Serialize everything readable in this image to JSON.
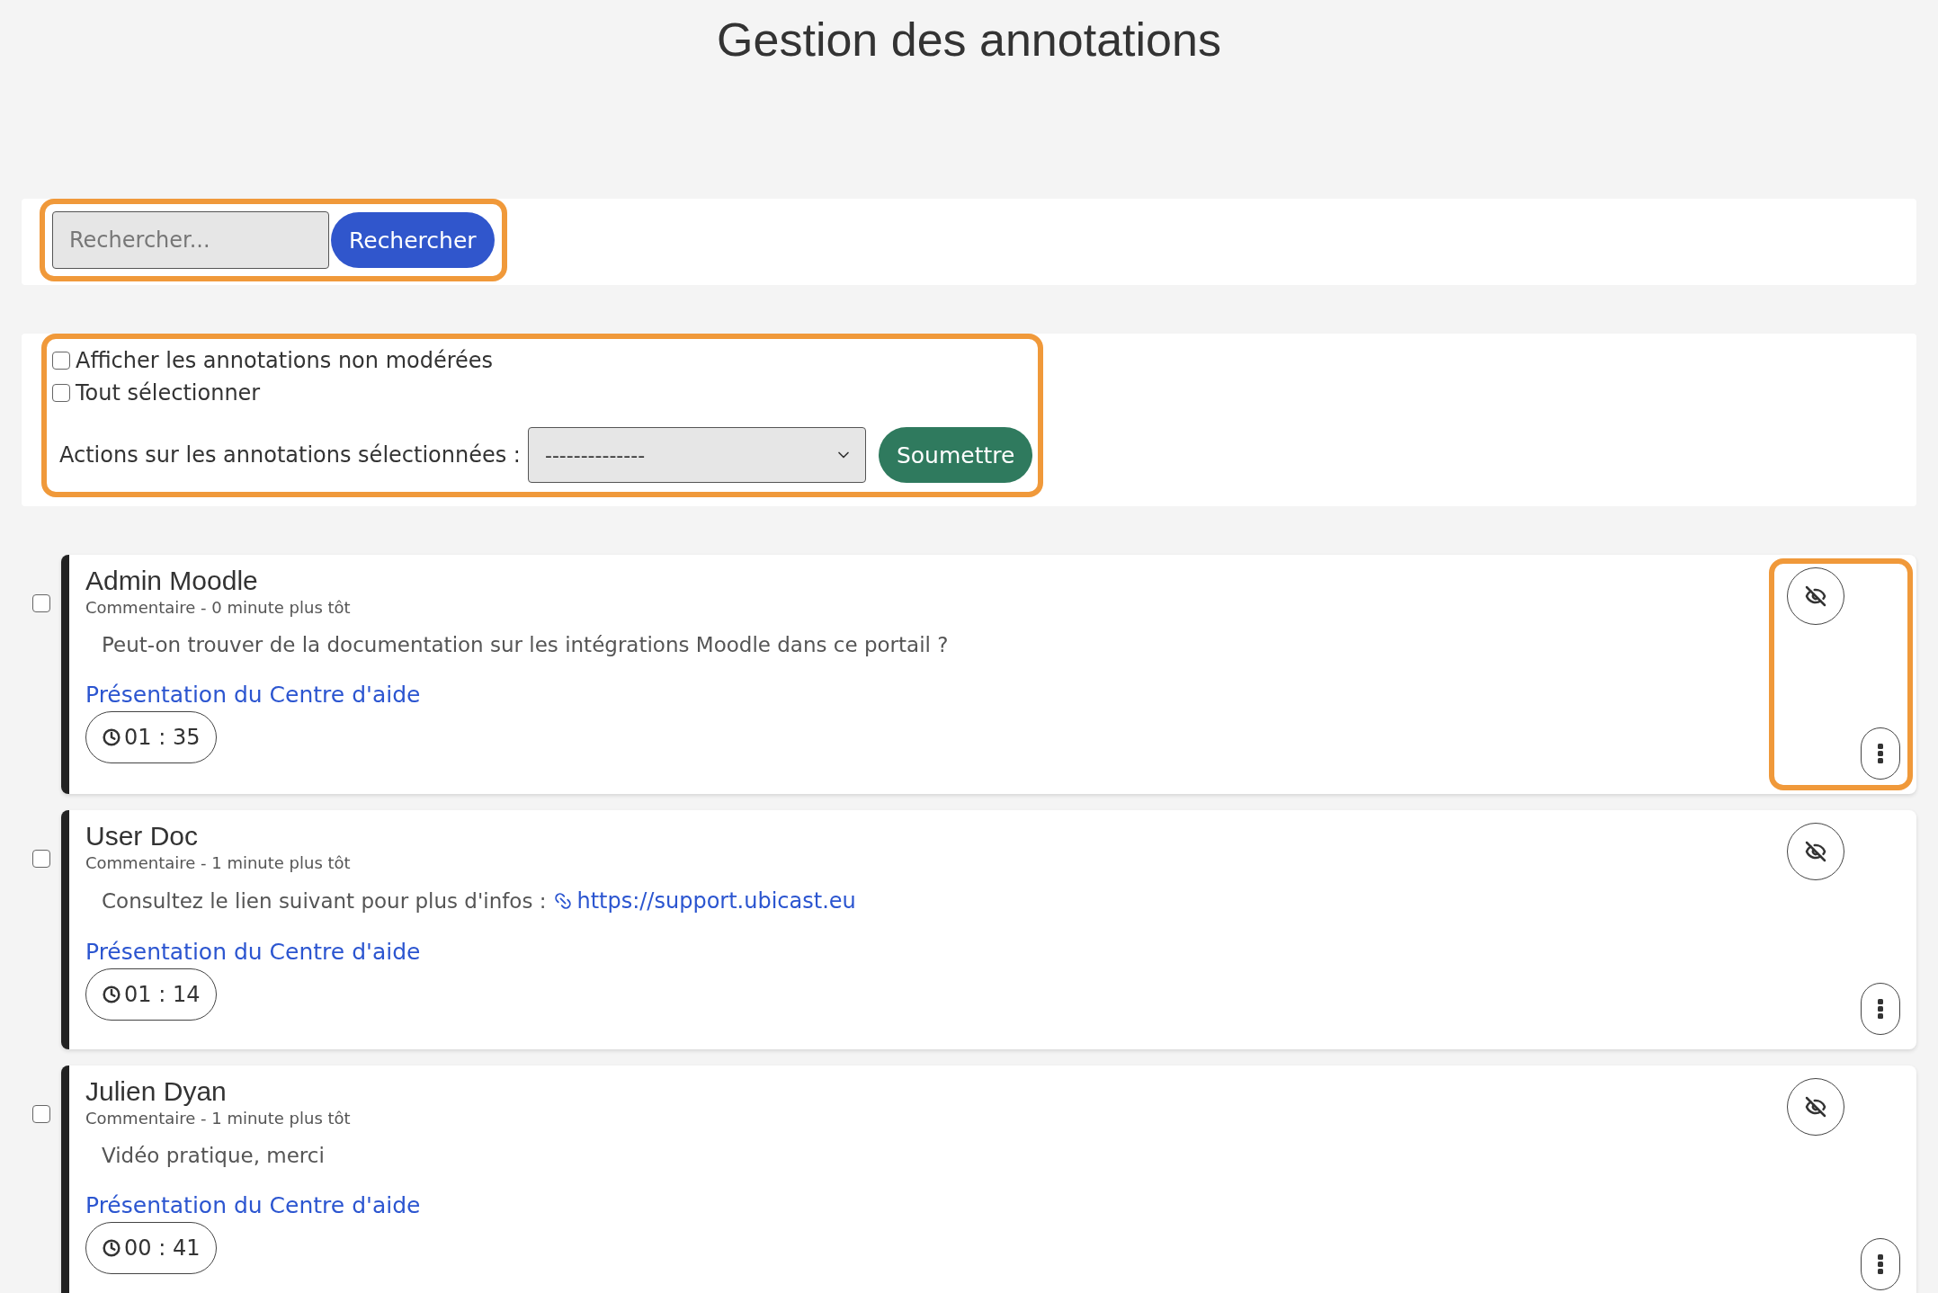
{
  "title": "Gestion des annotations",
  "search": {
    "placeholder": "Rechercher...",
    "button": "Rechercher",
    "highlighted": true
  },
  "filters": {
    "highlighted": true,
    "options": [
      {
        "label": "Afficher les annotations non modérées",
        "checked": false
      },
      {
        "label": "Tout sélectionner",
        "checked": false
      }
    ],
    "actions_label": "Actions sur les annotations sélectionnées :",
    "actions_value": "--------------",
    "submit": "Soumettre"
  },
  "annotations": [
    {
      "author": "Admin Moodle",
      "meta": "Commentaire - 0 minute plus tôt",
      "body": "Peut-on trouver de la documentation sur les intégrations Moodle dans ce portail ?",
      "media": "Présentation du Centre d'aide",
      "time": "01 : 35",
      "checked": false,
      "actions_highlighted": true
    },
    {
      "author": "User Doc",
      "meta": "Commentaire - 1 minute plus tôt",
      "body": "Consultez le lien suivant pour plus d'infos :",
      "link": "https://support.ubicast.eu",
      "media": "Présentation du Centre d'aide",
      "time": "01 : 14",
      "checked": false,
      "actions_highlighted": false
    },
    {
      "author": "Julien Dyan",
      "meta": "Commentaire - 1 minute plus tôt",
      "body": "Vidéo pratique, merci",
      "media": "Présentation du Centre d'aide",
      "time": "00 : 41",
      "checked": false,
      "actions_highlighted": false
    }
  ]
}
